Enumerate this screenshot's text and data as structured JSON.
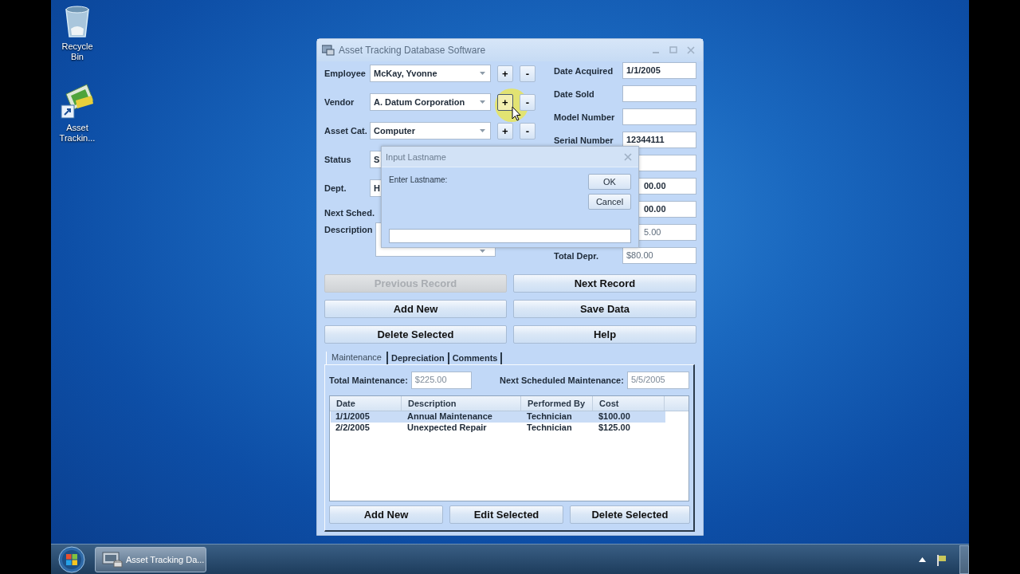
{
  "desktop_icons": [
    {
      "label": "Recycle Bin",
      "kind": "recycle"
    },
    {
      "label": "Asset Trackin...",
      "kind": "app_shortcut"
    }
  ],
  "window": {
    "title": "Asset Tracking Database Software"
  },
  "left_fields": [
    {
      "label": "Employee",
      "value": "McKay, Yvonne",
      "kind": "combo",
      "buttons": [
        {
          "label": "+",
          "hovered": false
        },
        {
          "label": "-",
          "hovered": false
        }
      ]
    },
    {
      "label": "Vendor",
      "value": "A. Datum Corporation",
      "kind": "combo",
      "buttons": [
        {
          "label": "+",
          "hovered": true
        },
        {
          "label": "-",
          "hovered": false
        }
      ]
    },
    {
      "label": "Asset Cat.",
      "value": "Computer",
      "kind": "combo",
      "buttons": [
        {
          "label": "+",
          "hovered": false
        },
        {
          "label": "-",
          "hovered": false
        }
      ]
    },
    {
      "label": "Status",
      "value": "S",
      "kind": "combo"
    },
    {
      "label": "Dept.",
      "value": "H",
      "kind": "combo"
    },
    {
      "label": "Next Sched.",
      "kind": "label"
    },
    {
      "label": "Description",
      "kind": "memo"
    }
  ],
  "right_fields": [
    {
      "kind": "text",
      "label": "Date Acquired",
      "value": "1/1/2005",
      "readonly": false
    },
    {
      "kind": "text",
      "label": "Date Sold"
    },
    {
      "kind": "text",
      "label": "Model Number"
    },
    {
      "kind": "text",
      "label": "Serial Number",
      "value": "12344111",
      "readonly": false
    },
    {
      "kind": "text"
    },
    {
      "kind": "text",
      "value": "00.00",
      "readonly": false
    },
    {
      "kind": "text",
      "value": "00.00",
      "readonly": false
    },
    {
      "kind": "text",
      "value": "5.00",
      "readonly": true
    },
    {
      "kind": "text",
      "label": "Total Depr.",
      "value": "$80.00",
      "readonly": true
    }
  ],
  "action_buttons": [
    {
      "label": "Previous Record",
      "disabled": true
    },
    {
      "label": "Next Record",
      "disabled": false
    },
    {
      "label": "Add New",
      "disabled": false
    },
    {
      "label": "Save Data",
      "disabled": false
    },
    {
      "label": "Delete Selected",
      "disabled": false
    },
    {
      "label": "Help",
      "disabled": false
    }
  ],
  "tabs": [
    {
      "label": "Maintenance",
      "selected": true
    },
    {
      "label": "Depreciation",
      "selected": false
    },
    {
      "label": "Comments",
      "selected": false
    }
  ],
  "maintenance": {
    "total_label": "Total Maintenance:",
    "total_value": "$225.00",
    "next_label": "Next Scheduled Maintenance:",
    "next_value": "5/5/2005",
    "columns": [
      "Date",
      "Description",
      "Performed By",
      "Cost"
    ],
    "rows": [
      {
        "cells": [
          "1/1/2005",
          "Annual Maintenance",
          "Technician",
          "$100.00"
        ],
        "selected": true
      },
      {
        "cells": [
          "2/2/2005",
          "Unexpected Repair",
          "Technician",
          "$125.00"
        ],
        "selected": false
      }
    ],
    "buttons": [
      "Add New",
      "Edit Selected",
      "Delete Selected"
    ]
  },
  "dialog": {
    "title": "Input Lastname",
    "prompt": "Enter Lastname:",
    "buttons": [
      "OK",
      "Cancel"
    ]
  },
  "taskbar": {
    "items": [
      {
        "label": "Asset Tracking Da..."
      }
    ]
  }
}
